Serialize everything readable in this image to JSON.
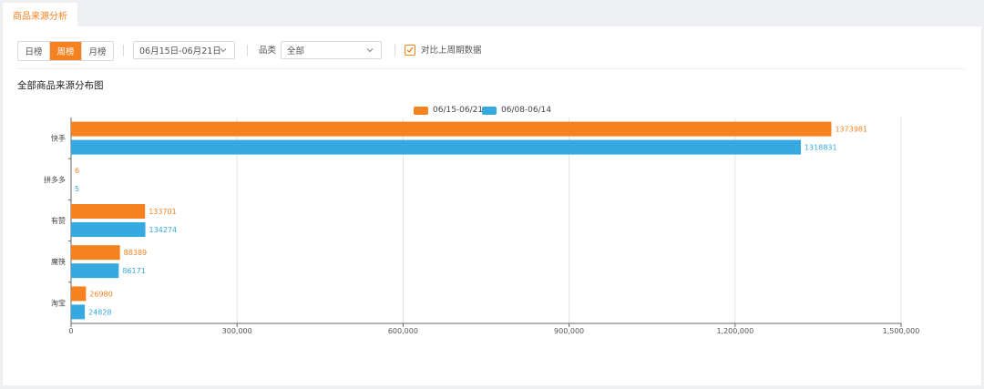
{
  "tab": {
    "label": "商品来源分析"
  },
  "filters": {
    "period_buttons": [
      {
        "label": "日榜",
        "active": false
      },
      {
        "label": "周榜",
        "active": true
      },
      {
        "label": "月榜",
        "active": false
      }
    ],
    "date_range": "06月15日-06月21日",
    "category_label": "品类",
    "category_value": "全部",
    "compare_checked": true,
    "compare_label": "对比上周期数据"
  },
  "colors": {
    "accent": "#f5821f",
    "current": "#f5821f",
    "previous": "#35a9e0"
  },
  "chart_data": {
    "type": "bar",
    "orientation": "horizontal",
    "title": "全部商品来源分布图",
    "categories": [
      "快手",
      "拼多多",
      "有赞",
      "魔筷",
      "淘宝"
    ],
    "series": [
      {
        "name": "06/15-06/21",
        "values": [
          1373981,
          6,
          133701,
          88389,
          26980
        ]
      },
      {
        "name": "06/08-06/14",
        "values": [
          1318831,
          5,
          134274,
          86171,
          24828
        ]
      }
    ],
    "xlim": [
      0,
      1500000
    ],
    "xticks": [
      "0",
      "300,000",
      "600,000",
      "900,000",
      "1,200,000",
      "1,500,000"
    ],
    "xtick_values": [
      0,
      300000,
      600000,
      900000,
      1200000,
      1500000
    ],
    "grid": true,
    "legend_position": "top-center",
    "data_labels": true
  }
}
